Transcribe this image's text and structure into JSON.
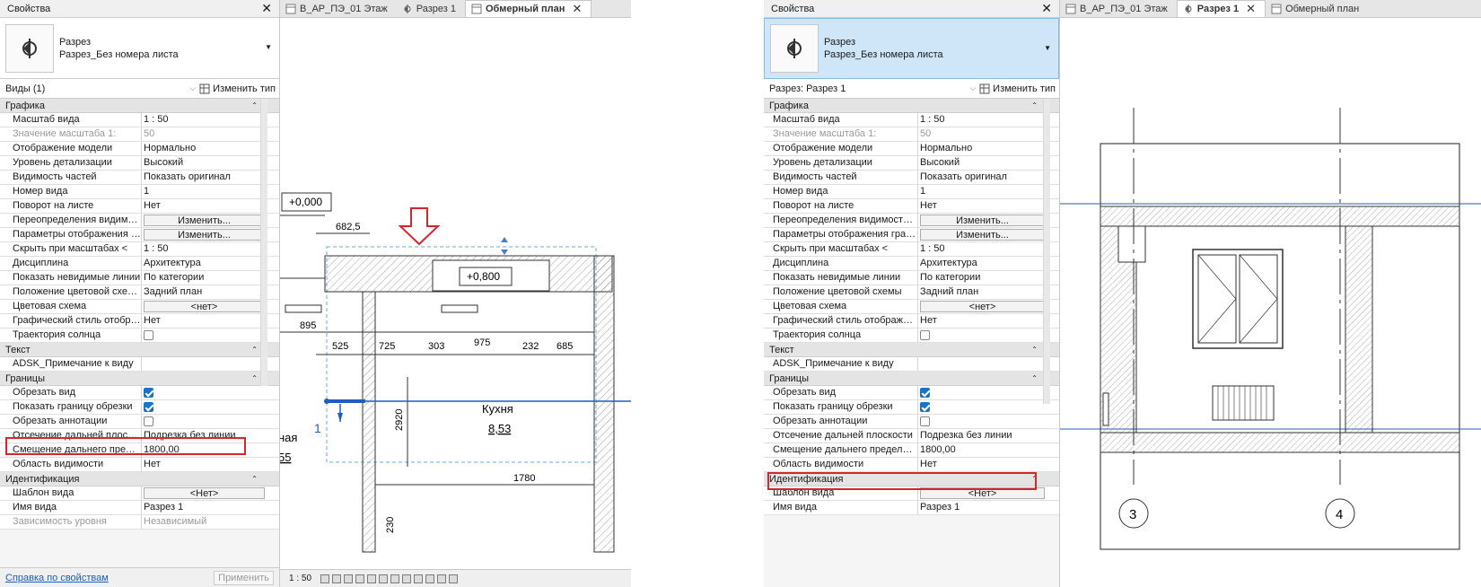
{
  "left": {
    "panel_title": "Свойства",
    "type_name": "Разрез",
    "type_sub": "Разрез_Без номера листа",
    "selector": "Виды (1)",
    "edit_type": "Изменить тип",
    "sections": {
      "graphics": "Графика",
      "text": "Текст",
      "extents": "Границы",
      "identity": "Идентификация"
    },
    "graphics_rows": [
      {
        "k": "Масштаб вида",
        "v": "1 : 50"
      },
      {
        "k": "Значение масштаба    1:",
        "v": "50"
      },
      {
        "k": "Отображение модели",
        "v": "Нормально"
      },
      {
        "k": "Уровень детализации",
        "v": "Высокий"
      },
      {
        "k": "Видимость частей",
        "v": "Показать оригинал"
      },
      {
        "k": "Номер вида",
        "v": "1"
      },
      {
        "k": "Поворот на листе",
        "v": "Нет"
      },
      {
        "k": "Переопределения видимости/...",
        "v": "Изменить..."
      },
      {
        "k": "Параметры отображения граф...",
        "v": "Изменить..."
      },
      {
        "k": "Скрыть при масштабах <",
        "v": "1 : 50"
      },
      {
        "k": "Дисциплина",
        "v": "Архитектура"
      },
      {
        "k": "Показать невидимые линии",
        "v": "По категории"
      },
      {
        "k": "Положение цветовой схемы",
        "v": "Задний план"
      },
      {
        "k": "Цветовая схема",
        "v": "<нет>"
      },
      {
        "k": "Графический стиль отображен...",
        "v": "Нет"
      },
      {
        "k": "Траектория солнца",
        "v": ""
      }
    ],
    "text_rows": [
      {
        "k": "ADSK_Примечание к виду",
        "v": ""
      }
    ],
    "extents_rows": [
      {
        "k": "Обрезать вид",
        "v": ""
      },
      {
        "k": "Показать границу обрезки",
        "v": ""
      },
      {
        "k": "Обрезать аннотации",
        "v": ""
      },
      {
        "k": "Отсечение дальней плоскости",
        "v": "Подрезка без линии"
      },
      {
        "k": "Смещение дальнего предела с...",
        "v": "1800,00"
      },
      {
        "k": "Область видимости",
        "v": "Нет"
      }
    ],
    "identity_rows": [
      {
        "k": "Шаблон вида",
        "v": "<Нет>"
      },
      {
        "k": "Имя вида",
        "v": "Разрез 1"
      },
      {
        "k": "Зависимость уровня",
        "v": "Независимый"
      }
    ],
    "help": "Справка по свойствам",
    "apply": "Применить",
    "tabs": [
      "В_АР_ПЭ_01 Этаж",
      "Разрез 1",
      "Обмерный план"
    ],
    "scale": "1 : 50",
    "plan": {
      "level1": "+0,000",
      "level2": "+0,800",
      "dims": [
        "682,5",
        "895",
        "525",
        "725",
        "303",
        "975",
        "232",
        "685",
        "2920",
        "1780",
        "230"
      ],
      "room_name": "Кухня",
      "room_area": "8,53",
      "section_mark": "1",
      "partial_room_name": "ная",
      "partial_room_area": "55"
    }
  },
  "right": {
    "panel_title": "Свойства",
    "type_name": "Разрез",
    "type_sub": "Разрез_Без номера листа",
    "selector": "Разрез: Разрез 1",
    "edit_type": "Изменить тип",
    "sections": {
      "graphics": "Графика",
      "text": "Текст",
      "extents": "Границы",
      "identity": "Идентификация"
    },
    "graphics_rows": [
      {
        "k": "Масштаб вида",
        "v": "1 : 50"
      },
      {
        "k": "Значение масштаба    1:",
        "v": "50"
      },
      {
        "k": "Отображение модели",
        "v": "Нормально"
      },
      {
        "k": "Уровень детализации",
        "v": "Высокий"
      },
      {
        "k": "Видимость частей",
        "v": "Показать оригинал"
      },
      {
        "k": "Номер вида",
        "v": "1"
      },
      {
        "k": "Поворот на листе",
        "v": "Нет"
      },
      {
        "k": "Переопределения видимости/...",
        "v": "Изменить..."
      },
      {
        "k": "Параметры отображения граф...",
        "v": "Изменить..."
      },
      {
        "k": "Скрыть при масштабах <",
        "v": "1 : 50"
      },
      {
        "k": "Дисциплина",
        "v": "Архитектура"
      },
      {
        "k": "Показать невидимые линии",
        "v": "По категории"
      },
      {
        "k": "Положение цветовой схемы",
        "v": "Задний план"
      },
      {
        "k": "Цветовая схема",
        "v": "<нет>"
      },
      {
        "k": "Графический стиль отображен...",
        "v": "Нет"
      },
      {
        "k": "Траектория солнца",
        "v": ""
      }
    ],
    "text_rows": [
      {
        "k": "ADSK_Примечание к виду",
        "v": ""
      }
    ],
    "extents_rows": [
      {
        "k": "Обрезать вид",
        "v": ""
      },
      {
        "k": "Показать границу обрезки",
        "v": ""
      },
      {
        "k": "Обрезать аннотации",
        "v": ""
      },
      {
        "k": "Отсечение дальней плоскости",
        "v": "Подрезка без линии"
      },
      {
        "k": "Смещение дальнего предела с...",
        "v": "1800,00"
      },
      {
        "k": "Область видимости",
        "v": "Нет"
      }
    ],
    "identity_rows": [
      {
        "k": "Шаблон вида",
        "v": "<Нет>"
      },
      {
        "k": "Имя вида",
        "v": "Разрез 1"
      }
    ],
    "tabs": [
      "В_АР_ПЭ_01 Этаж",
      "Разрез 1",
      "Обмерный план"
    ],
    "grid_labels": [
      "3",
      "4"
    ]
  },
  "colors": {
    "highlight": "#d4272c",
    "accent": "#1b73c6",
    "selection": "#cfe6f8",
    "section_line": "#1f5fbf"
  },
  "icons": [
    "section-view-icon",
    "close-icon",
    "floor-plan-icon",
    "section-icon",
    "edit-type-icon",
    "checkbox-checked-icon",
    "checkbox-empty-icon",
    "down-arrow-icon"
  ]
}
